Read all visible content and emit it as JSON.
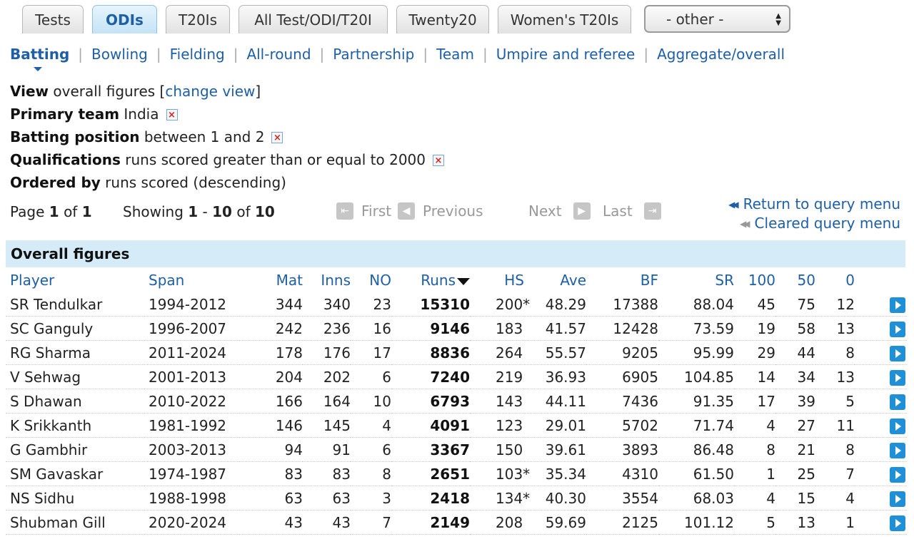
{
  "tabs": [
    "Tests",
    "ODIs",
    "T20Is",
    "All Test/ODI/T20I",
    "Twenty20",
    "Women's T20Is"
  ],
  "active_tab": "ODIs",
  "other_select": "- other -",
  "subnav": [
    "Batting",
    "Bowling",
    "Fielding",
    "All-round",
    "Partnership",
    "Team",
    "Umpire and referee",
    "Aggregate/overall"
  ],
  "filters": {
    "view_label": "View",
    "view_value": "overall figures [",
    "view_link": "change view",
    "view_end": "]",
    "team_label": "Primary team",
    "team_value": "India",
    "position_label": "Batting position",
    "position_value": "between 1 and 2",
    "qual_label": "Qualifications",
    "qual_value": "runs scored greater than or equal to 2000",
    "order_label": "Ordered by",
    "order_value": "runs scored (descending)"
  },
  "paging": {
    "page_label": "Page",
    "page": "1",
    "of": "of",
    "pages": "1",
    "showing_label": "Showing",
    "from": "1",
    "dash": "-",
    "to": "10",
    "total": "10",
    "first": "First",
    "previous": "Previous",
    "next": "Next",
    "last": "Last",
    "return_link": "Return to query menu",
    "cleared_link": "Cleared query menu"
  },
  "table": {
    "caption": "Overall figures",
    "headers": [
      "Player",
      "Span",
      "Mat",
      "Inns",
      "NO",
      "Runs",
      "HS",
      "Ave",
      "BF",
      "SR",
      "100",
      "50",
      "0"
    ],
    "rows": [
      [
        "SR Tendulkar",
        "1994-2012",
        "344",
        "340",
        "23",
        "15310",
        "200*",
        "48.29",
        "17388",
        "88.04",
        "45",
        "75",
        "12"
      ],
      [
        "SC Ganguly",
        "1996-2007",
        "242",
        "236",
        "16",
        "9146",
        "183",
        "41.57",
        "12428",
        "73.59",
        "19",
        "58",
        "13"
      ],
      [
        "RG Sharma",
        "2011-2024",
        "178",
        "176",
        "17",
        "8836",
        "264",
        "55.57",
        "9205",
        "95.99",
        "29",
        "44",
        "8"
      ],
      [
        "V Sehwag",
        "2001-2013",
        "204",
        "202",
        "6",
        "7240",
        "219",
        "36.93",
        "6905",
        "104.85",
        "14",
        "34",
        "13"
      ],
      [
        "S Dhawan",
        "2010-2022",
        "166",
        "164",
        "10",
        "6793",
        "143",
        "44.11",
        "7436",
        "91.35",
        "17",
        "39",
        "5"
      ],
      [
        "K Srikkanth",
        "1981-1992",
        "146",
        "145",
        "4",
        "4091",
        "123",
        "29.01",
        "5702",
        "71.74",
        "4",
        "27",
        "11"
      ],
      [
        "G Gambhir",
        "2003-2013",
        "94",
        "91",
        "6",
        "3367",
        "150",
        "39.61",
        "3893",
        "86.48",
        "8",
        "21",
        "8"
      ],
      [
        "SM Gavaskar",
        "1974-1987",
        "83",
        "83",
        "8",
        "2651",
        "103*",
        "35.34",
        "4310",
        "61.50",
        "1",
        "25",
        "7"
      ],
      [
        "NS Sidhu",
        "1988-1998",
        "63",
        "63",
        "3",
        "2418",
        "134*",
        "40.30",
        "3554",
        "68.03",
        "4",
        "15",
        "4"
      ],
      [
        "Shubman Gill",
        "2020-2024",
        "43",
        "43",
        "7",
        "2149",
        "208",
        "59.69",
        "2125",
        "101.12",
        "5",
        "13",
        "1"
      ]
    ]
  }
}
